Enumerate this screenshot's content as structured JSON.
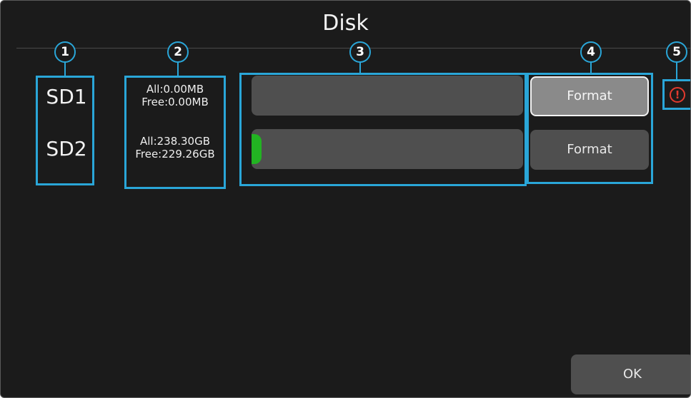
{
  "title": "Disk",
  "callouts": [
    "1",
    "2",
    "3",
    "4",
    "5"
  ],
  "disks": [
    {
      "name": "SD1",
      "all": "All:0.00MB",
      "free": "Free:0.00MB",
      "used_fraction": 0.0,
      "format_label": "Format",
      "format_selected": true,
      "status_icon": "warning-icon"
    },
    {
      "name": "SD2",
      "all": "All:238.30GB",
      "free": "Free:229.26GB",
      "used_fraction": 0.038,
      "format_label": "Format",
      "format_selected": false
    }
  ],
  "ok_label": "OK",
  "colors": {
    "background": "#1b1b1b",
    "annotation": "#2aa6d8",
    "bar_track": "#4f4f4f",
    "bar_fill": "#22b422",
    "button": "#4f4f4f",
    "button_selected": "#8a8a8a",
    "warning": "#e23a2e"
  }
}
